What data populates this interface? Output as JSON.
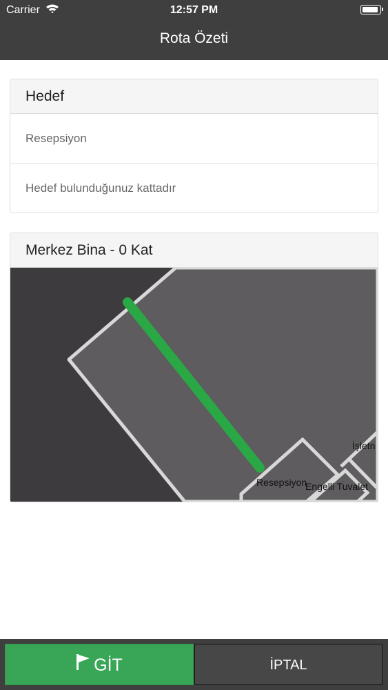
{
  "status_bar": {
    "carrier": "Carrier",
    "time": "12:57 PM",
    "battery_level": 0.95
  },
  "nav": {
    "title": "Rota Özeti"
  },
  "destination_card": {
    "header": "Hedef",
    "name": "Resepsiyon",
    "note": "Hedef bulunduğunuz kattadır"
  },
  "map_card": {
    "header": "Merkez Bina - 0 Kat",
    "labels": {
      "reception": "Resepsiyon",
      "accessible_toilet": "Engelli Tuvalet",
      "business": "İşletn"
    },
    "route_color": "#2aa845"
  },
  "actions": {
    "go_label": "GİT",
    "cancel_label": "İPTAL"
  },
  "colors": {
    "go": "#38a557",
    "bar": "#3f3f3f"
  }
}
